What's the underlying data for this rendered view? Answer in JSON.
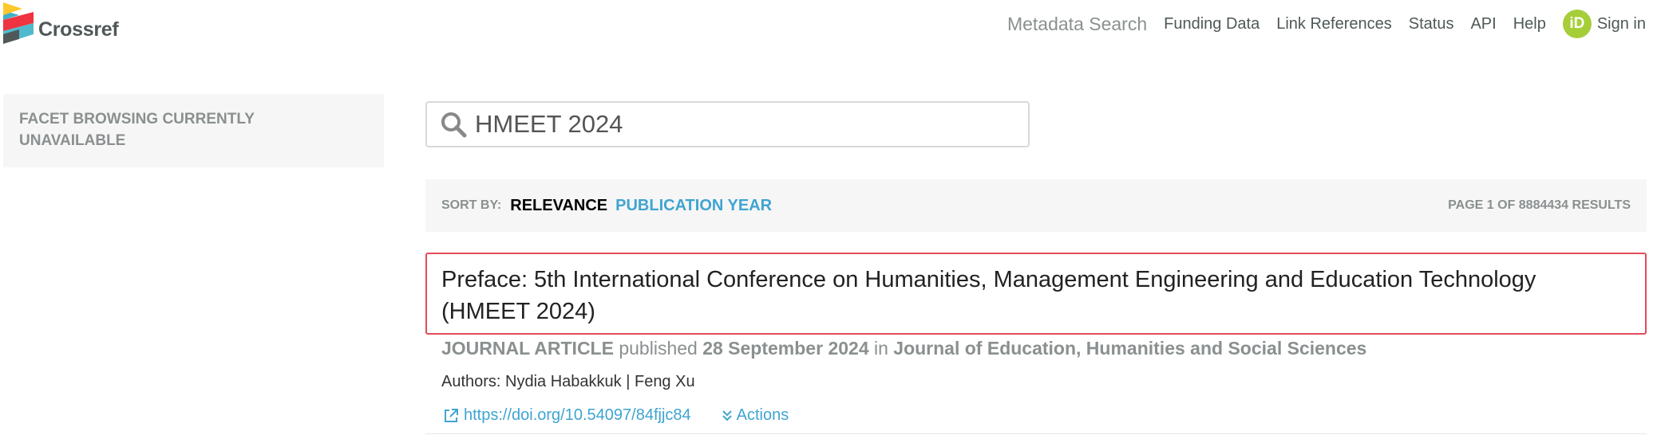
{
  "header": {
    "brand": "Crossref",
    "nav": [
      {
        "label": "Metadata Search",
        "primary": true
      },
      {
        "label": "Funding Data"
      },
      {
        "label": "Link References"
      },
      {
        "label": "Status"
      },
      {
        "label": "API"
      },
      {
        "label": "Help"
      }
    ],
    "orcid_badge": "iD",
    "sign_in": "Sign in"
  },
  "facet": {
    "text": "FACET BROWSING CURRENTLY UNAVAILABLE"
  },
  "search": {
    "value": "HMEET 2024",
    "icon": "search-icon"
  },
  "sort": {
    "label": "SORT BY:",
    "options": [
      "RELEVANCE",
      "PUBLICATION YEAR"
    ],
    "active": "RELEVANCE",
    "page_info": "PAGE 1 OF 8884434 RESULTS"
  },
  "result": {
    "title": "Preface: 5th International Conference on Humanities, Management Engineering and Education Technology (HMEET 2024)",
    "type": "JOURNAL ARTICLE",
    "published_word": "published",
    "date": "28 September 2024",
    "in_word": "in",
    "journal": "Journal of Education, Humanities and Social Sciences",
    "authors": "Authors: Nydia Habakkuk | Feng Xu",
    "doi": "https://doi.org/10.54097/84fjjc84",
    "actions": "Actions"
  },
  "colors": {
    "accent": "#3fa4d1",
    "highlight": "#e24b5a",
    "orcid": "#a6ce39"
  }
}
